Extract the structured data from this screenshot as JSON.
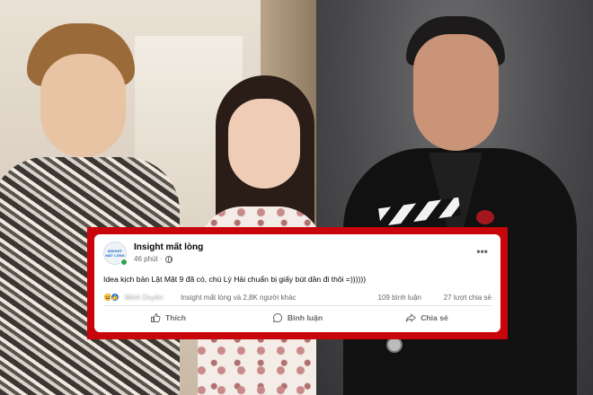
{
  "post": {
    "page_name": "Insight mất lòng",
    "avatar_text": "INSIGHT MẤT LÒNG",
    "time": "46 phút ·",
    "more": "•••",
    "text": "Idea kịch bản Lật Mặt 9 đã có, chú Lý Hải chuẩn bị giấy bút dần đi thôi =))))))",
    "reactions": {
      "blurred_name": "Minh Duyên",
      "summary": "Insight mất lòng và 2,8K người khác",
      "comments": "109 bình luận",
      "shares": "27 lượt chia sẻ"
    },
    "actions": {
      "like": "Thích",
      "comment": "Bình luận",
      "share": "Chia sẻ"
    }
  },
  "colors": {
    "frame": "#c8050b",
    "card": "#ffffff",
    "text_secondary": "#65676b",
    "like_blue": "#1877f2"
  }
}
